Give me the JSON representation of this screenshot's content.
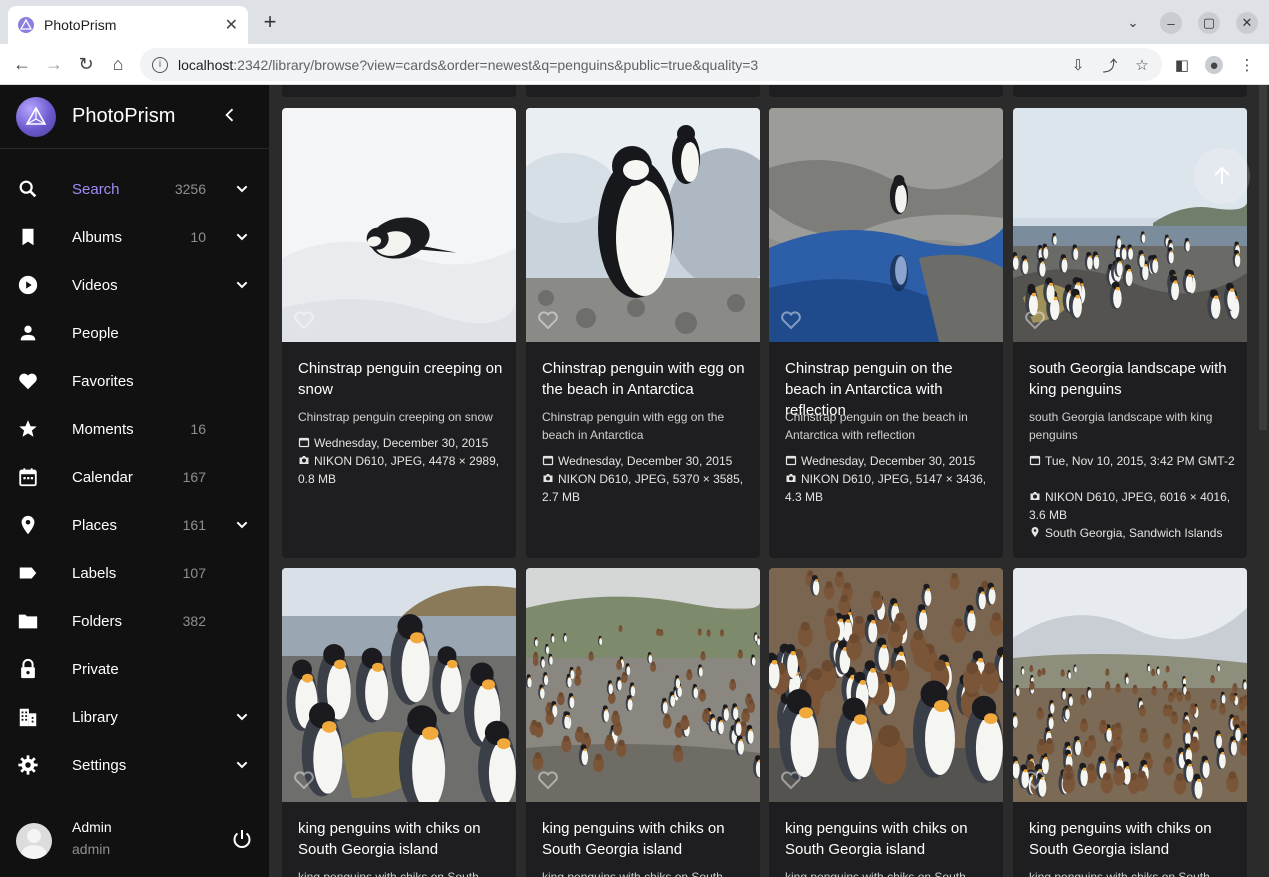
{
  "browser": {
    "tab_title": "PhotoPrism",
    "url_host": "localhost",
    "url_path": ":2342/library/browse?view=cards&order=newest&q=penguins&public=true&quality=3"
  },
  "app": {
    "title": "PhotoPrism",
    "accent_color": "#a28bf5"
  },
  "sidebar": {
    "items": [
      {
        "label": "Search",
        "count": "3256",
        "icon": "search-icon",
        "expandable": true,
        "active": true
      },
      {
        "label": "Albums",
        "count": "10",
        "icon": "bookmark-icon",
        "expandable": true
      },
      {
        "label": "Videos",
        "count": "",
        "icon": "play-circle-icon",
        "expandable": true
      },
      {
        "label": "People",
        "count": "",
        "icon": "person-icon",
        "expandable": false
      },
      {
        "label": "Favorites",
        "count": "",
        "icon": "heart-icon",
        "expandable": false
      },
      {
        "label": "Moments",
        "count": "16",
        "icon": "star-icon",
        "expandable": false
      },
      {
        "label": "Calendar",
        "count": "167",
        "icon": "calendar-icon",
        "expandable": false
      },
      {
        "label": "Places",
        "count": "161",
        "icon": "place-icon",
        "expandable": true
      },
      {
        "label": "Labels",
        "count": "107",
        "icon": "label-icon",
        "expandable": false
      },
      {
        "label": "Folders",
        "count": "382",
        "icon": "folder-icon",
        "expandable": false
      },
      {
        "label": "Private",
        "count": "",
        "icon": "lock-icon",
        "expandable": false
      },
      {
        "label": "Library",
        "count": "",
        "icon": "library-icon",
        "expandable": true
      },
      {
        "label": "Settings",
        "count": "",
        "icon": "gear-icon",
        "expandable": true
      }
    ],
    "user": {
      "name": "Admin",
      "login": "admin"
    }
  },
  "cards": [
    {
      "title": "Chinstrap penguin creeping on snow",
      "description": "Chinstrap penguin creeping on snow",
      "date": "Wednesday, December 30, 2015",
      "camera": "NIKON D610, JPEG, 4478 × 2989, 0.8 MB",
      "location": "",
      "photo": "snow"
    },
    {
      "title": "Chinstrap penguin with egg on the beach in Antarctica",
      "description": "Chinstrap penguin with egg on the beach in Antarctica",
      "date": "Wednesday, December 30, 2015",
      "camera": "NIKON D610, JPEG, 5370 × 3585, 2.7 MB",
      "location": "",
      "photo": "nest"
    },
    {
      "title": "Chinstrap penguin on the beach in Antarctica with reflection",
      "description": "Chinstrap penguin on the beach in Antarctica with reflection",
      "date": "Wednesday, December 30, 2015",
      "camera": "NIKON D610, JPEG, 5147 × 3436, 4.3 MB",
      "location": "",
      "photo": "rock"
    },
    {
      "title": "south Georgia landscape with king penguins",
      "description": "south Georgia landscape with king penguins",
      "date": "Tue, Nov 10, 2015, 3:42 PM GMT-2",
      "camera": "NIKON D610, JPEG, 6016 × 4016, 3.6 MB",
      "location": "South Georgia, Sandwich Islands",
      "photo": "beach"
    },
    {
      "title": "king penguins with chiks on South Georgia island",
      "description": "king penguins with chiks on South",
      "photo": "king1"
    },
    {
      "title": "king penguins with chiks on South Georgia island",
      "description": "king penguins with chiks on South",
      "photo": "king2"
    },
    {
      "title": "king penguins with chiks on South Georgia island",
      "description": "king penguins with chiks on South",
      "photo": "king3"
    },
    {
      "title": "king penguins with chiks on South Georgia island",
      "description": "king penguins with chiks on South",
      "photo": "king4"
    }
  ]
}
